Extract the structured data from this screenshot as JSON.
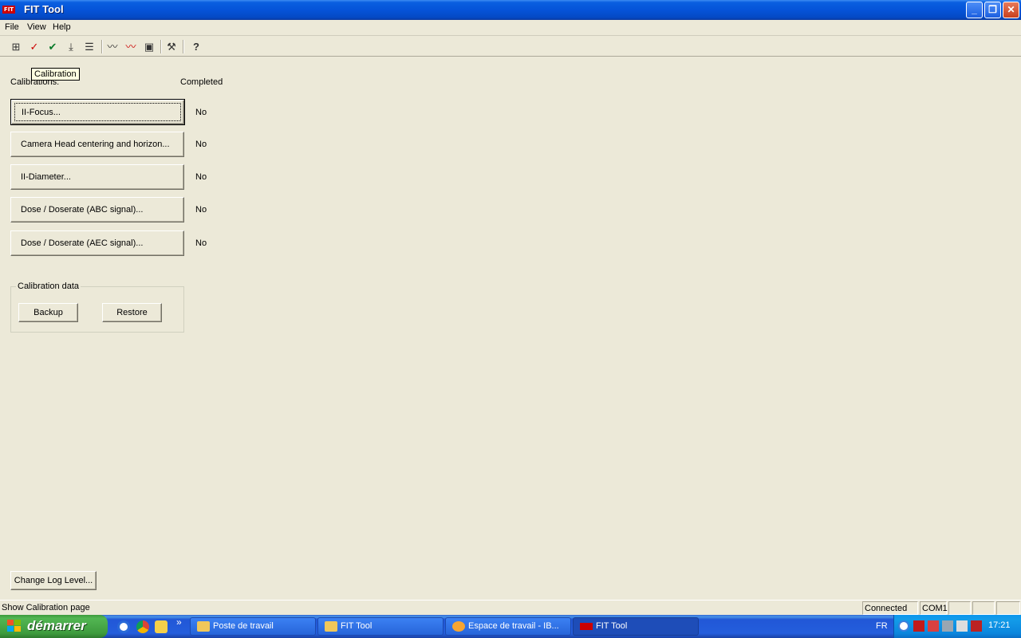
{
  "window": {
    "app_icon_text": "FIT",
    "title": "FIT Tool",
    "minimize_glyph": "_",
    "restore_glyph": "❐",
    "close_glyph": "✕"
  },
  "menu": [
    "File",
    "View",
    "Help"
  ],
  "toolbar": {
    "icons": [
      "tree-view-icon",
      "calibration-icon",
      "check-icon",
      "download-icon",
      "list-run-icon",
      "graph-icon",
      "graph-alert-icon",
      "chart-monitor-icon",
      "hammer-icon",
      "help-icon"
    ],
    "glyphs": [
      "⊞",
      "✓",
      "✔",
      "⤓",
      "☰",
      "〰",
      "〰",
      "▣",
      "⚒",
      "?"
    ],
    "tooltip": "Calibration"
  },
  "calibrations": {
    "header": "Calibrations:",
    "completed_header": "Completed",
    "items": [
      {
        "label": "II-Focus...",
        "completed": "No"
      },
      {
        "label": "Camera Head centering and horizon...",
        "completed": "No"
      },
      {
        "label": "II-Diameter...",
        "completed": "No"
      },
      {
        "label": "Dose / Doserate (ABC signal)...",
        "completed": "No"
      },
      {
        "label": "Dose / Doserate (AEC signal)...",
        "completed": "No"
      }
    ]
  },
  "calibration_data": {
    "title": "Calibration data",
    "backup": "Backup",
    "restore": "Restore"
  },
  "change_log_level": "Change Log Level...",
  "status": {
    "text": "Show Calibration page",
    "connection": "Connected",
    "port": "COM1"
  },
  "taskbar": {
    "start": "démarrer",
    "tasks": [
      {
        "label": "Poste de travail",
        "active": false
      },
      {
        "label": "FIT Tool",
        "active": false
      },
      {
        "label": "Espace de travail - IB...",
        "active": false
      },
      {
        "label": "FIT Tool",
        "active": true
      }
    ],
    "language": "FR",
    "clock": "17:21",
    "chevron": "»",
    "colors": {
      "start": "#3d9b3d",
      "taskbar": "#245edc",
      "tray": "#0b86dd"
    }
  }
}
